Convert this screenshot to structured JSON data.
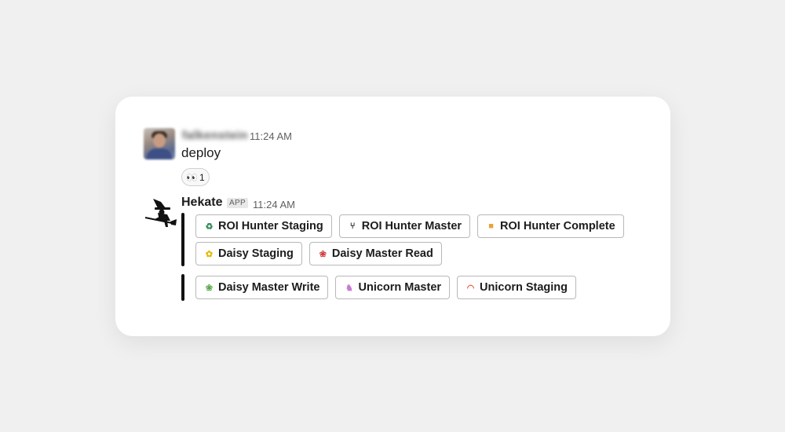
{
  "user_message": {
    "username": "falkenstein",
    "timestamp": "11:24 AM",
    "text": "deploy",
    "reaction": {
      "icon": "eyes-emoji",
      "glyph": "👀",
      "count": "1"
    }
  },
  "bot_message": {
    "name": "Hekate",
    "badge": "APP",
    "timestamp": "11:24 AM",
    "icon": "witch-on-broom-icon",
    "attachments": [
      {
        "rows": [
          [
            {
              "emoji": "♻",
              "emoji_color": "#2e8b57",
              "label": "ROI Hunter Staging"
            },
            {
              "emoji": "⑂",
              "emoji_color": "#222222",
              "label": "ROI Hunter Master"
            },
            {
              "emoji": "■",
              "emoji_color": "#e8a23a",
              "label": "ROI Hunter Complete"
            }
          ],
          [
            {
              "emoji": "✿",
              "emoji_color": "#e6b800",
              "label": "Daisy Staging"
            },
            {
              "emoji": "❀",
              "emoji_color": "#d33b3b",
              "label": "Daisy Master Read"
            }
          ]
        ]
      },
      {
        "rows": [
          [
            {
              "emoji": "❀",
              "emoji_color": "#5aa84b",
              "label": "Daisy Master Write"
            },
            {
              "emoji": "♞",
              "emoji_color": "#c77ad6",
              "label": "Unicorn Master"
            },
            {
              "emoji": "◠",
              "emoji_color": "#e8573a",
              "label": "Unicorn Staging"
            }
          ]
        ]
      }
    ]
  }
}
